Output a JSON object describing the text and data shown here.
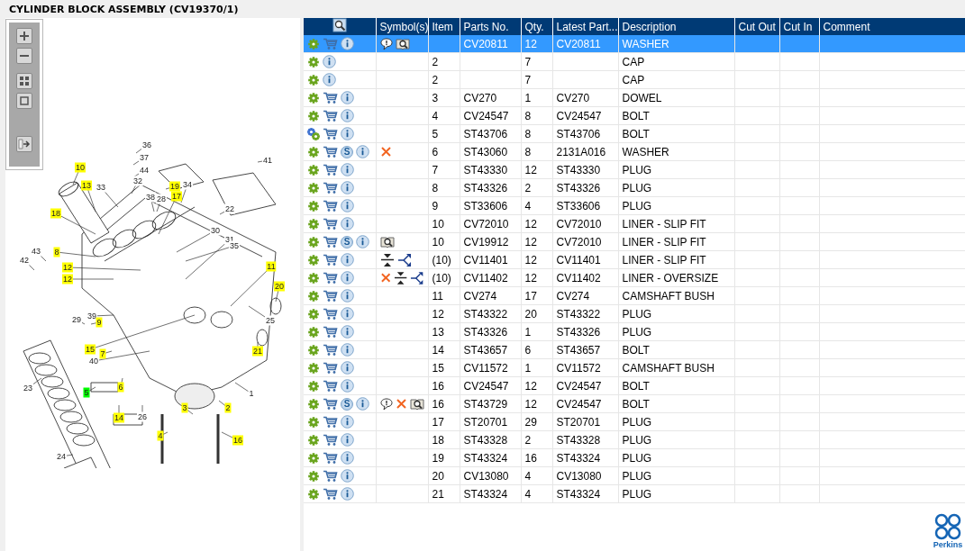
{
  "title": "CYLINDER BLOCK ASSEMBLY (CV19370/1)",
  "toolbar": [
    {
      "kind": "zoom-in"
    },
    {
      "kind": "zoom-out"
    },
    {
      "kind": "fit"
    },
    {
      "kind": "actual"
    },
    {
      "kind": "export"
    }
  ],
  "callouts": [
    {
      "label": "36"
    },
    {
      "label": "37"
    },
    {
      "label": "44"
    },
    {
      "label": "41"
    },
    {
      "label": "10",
      "color": "#ffff00"
    },
    {
      "label": "13",
      "color": "#ffff00"
    },
    {
      "label": "33"
    },
    {
      "label": "32"
    },
    {
      "label": "19",
      "color": "#ffff00"
    },
    {
      "label": "34"
    },
    {
      "label": "38"
    },
    {
      "label": "28"
    },
    {
      "label": "17",
      "color": "#ffff00"
    },
    {
      "label": "22"
    },
    {
      "label": "18",
      "color": "#ffff00"
    },
    {
      "label": "30"
    },
    {
      "label": "31"
    },
    {
      "label": "43"
    },
    {
      "label": "35"
    },
    {
      "label": "42"
    },
    {
      "label": "8",
      "color": "#ffff00"
    },
    {
      "label": "12",
      "color": "#ffff00"
    },
    {
      "label": "12",
      "color": "#ffff00"
    },
    {
      "label": "11",
      "color": "#ffff00"
    },
    {
      "label": "20",
      "color": "#ffff00"
    },
    {
      "label": "39"
    },
    {
      "label": "29"
    },
    {
      "label": "9",
      "color": "#ffff00"
    },
    {
      "label": "25"
    },
    {
      "label": "15",
      "color": "#ffff00"
    },
    {
      "label": "7",
      "color": "#ffff00"
    },
    {
      "label": "40"
    },
    {
      "label": "21",
      "color": "#ffff00"
    },
    {
      "label": "23"
    },
    {
      "label": "5",
      "color": "#00ff00"
    },
    {
      "label": "6",
      "color": "#ffff00"
    },
    {
      "label": "1"
    },
    {
      "label": "3",
      "color": "#ffff00"
    },
    {
      "label": "2",
      "color": "#ffff00"
    },
    {
      "label": "14",
      "color": "#ffff00"
    },
    {
      "label": "26"
    },
    {
      "label": "4",
      "color": "#ffff00"
    },
    {
      "label": "16",
      "color": "#ffff00"
    },
    {
      "label": "24"
    }
  ],
  "table": {
    "columns": [
      "Symbol(s)",
      "Item",
      "Parts No.",
      "Qty.",
      "Latest Part...",
      "Description",
      "Cut Out",
      "Cut In",
      "Comment"
    ],
    "rows": [
      {
        "selected": true,
        "icons": [
          {
            "kind": "gear"
          },
          {
            "kind": "cart"
          },
          {
            "kind": "info"
          }
        ],
        "symbols": [
          {
            "kind": "note"
          },
          {
            "kind": "book"
          }
        ],
        "item": "",
        "part": "CV20811",
        "qty": "12",
        "latest": "CV20811",
        "description": "WASHER"
      },
      {
        "selected": false,
        "icons": [
          {
            "kind": "gear"
          },
          {
            "kind": "info"
          }
        ],
        "symbols": [],
        "item": "2",
        "part": "",
        "qty": "7",
        "latest": "",
        "description": "CAP"
      },
      {
        "selected": false,
        "icons": [
          {
            "kind": "gear"
          },
          {
            "kind": "info"
          }
        ],
        "symbols": [],
        "item": "2",
        "part": "",
        "qty": "7",
        "latest": "",
        "description": "CAP"
      },
      {
        "selected": false,
        "icons": [
          {
            "kind": "gear"
          },
          {
            "kind": "cart"
          },
          {
            "kind": "info"
          }
        ],
        "symbols": [],
        "item": "3",
        "part": "CV270",
        "qty": "1",
        "latest": "CV270",
        "description": "DOWEL"
      },
      {
        "selected": false,
        "icons": [
          {
            "kind": "gear"
          },
          {
            "kind": "cart"
          },
          {
            "kind": "info"
          }
        ],
        "symbols": [],
        "item": "4",
        "part": "CV24547",
        "qty": "8",
        "latest": "CV24547",
        "description": "BOLT"
      },
      {
        "selected": false,
        "icons": [
          {
            "kind": "gears"
          },
          {
            "kind": "cart"
          },
          {
            "kind": "info"
          }
        ],
        "symbols": [],
        "item": "5",
        "part": "ST43706",
        "qty": "8",
        "latest": "ST43706",
        "description": "BOLT"
      },
      {
        "selected": false,
        "icons": [
          {
            "kind": "gear"
          },
          {
            "kind": "cart"
          },
          {
            "kind": "badge",
            "label": "S"
          },
          {
            "kind": "info"
          }
        ],
        "symbols": [
          {
            "kind": "cross"
          }
        ],
        "item": "6",
        "part": "ST43060",
        "qty": "8",
        "latest": "2131A016",
        "description": "WASHER"
      },
      {
        "selected": false,
        "icons": [
          {
            "kind": "gear"
          },
          {
            "kind": "cart"
          },
          {
            "kind": "info"
          }
        ],
        "symbols": [],
        "item": "7",
        "part": "ST43330",
        "qty": "12",
        "latest": "ST43330",
        "description": "PLUG"
      },
      {
        "selected": false,
        "icons": [
          {
            "kind": "gear"
          },
          {
            "kind": "cart"
          },
          {
            "kind": "info"
          }
        ],
        "symbols": [],
        "item": "8",
        "part": "ST43326",
        "qty": "2",
        "latest": "ST43326",
        "description": "PLUG"
      },
      {
        "selected": false,
        "icons": [
          {
            "kind": "gear"
          },
          {
            "kind": "cart"
          },
          {
            "kind": "info"
          }
        ],
        "symbols": [],
        "item": "9",
        "part": "ST33606",
        "qty": "4",
        "latest": "ST33606",
        "description": "PLUG"
      },
      {
        "selected": false,
        "icons": [
          {
            "kind": "gear"
          },
          {
            "kind": "cart"
          },
          {
            "kind": "info"
          }
        ],
        "symbols": [],
        "item": "10",
        "part": "CV72010",
        "qty": "12",
        "latest": "CV72010",
        "description": "LINER - SLIP FIT"
      },
      {
        "selected": false,
        "icons": [
          {
            "kind": "gear"
          },
          {
            "kind": "cart"
          },
          {
            "kind": "badge",
            "label": "S"
          },
          {
            "kind": "info"
          }
        ],
        "symbols": [
          {
            "kind": "book"
          }
        ],
        "item": "10",
        "part": "CV19912",
        "qty": "12",
        "latest": "CV72010",
        "description": "LINER - SLIP FIT"
      },
      {
        "selected": false,
        "icons": [
          {
            "kind": "gear"
          },
          {
            "kind": "cart"
          },
          {
            "kind": "info"
          }
        ],
        "symbols": [
          {
            "kind": "split"
          },
          {
            "kind": "branch"
          }
        ],
        "item": "(10)",
        "part": "CV11401",
        "qty": "12",
        "latest": "CV11401",
        "description": "LINER - SLIP FIT"
      },
      {
        "selected": false,
        "icons": [
          {
            "kind": "gear"
          },
          {
            "kind": "cart"
          },
          {
            "kind": "info"
          }
        ],
        "symbols": [
          {
            "kind": "cross"
          },
          {
            "kind": "split"
          },
          {
            "kind": "branch"
          }
        ],
        "item": "(10)",
        "part": "CV11402",
        "qty": "12",
        "latest": "CV11402",
        "description": "LINER - OVERSIZE"
      },
      {
        "selected": false,
        "icons": [
          {
            "kind": "gear"
          },
          {
            "kind": "cart"
          },
          {
            "kind": "info"
          }
        ],
        "symbols": [],
        "item": "11",
        "part": "CV274",
        "qty": "17",
        "latest": "CV274",
        "description": "CAMSHAFT BUSH"
      },
      {
        "selected": false,
        "icons": [
          {
            "kind": "gear"
          },
          {
            "kind": "cart"
          },
          {
            "kind": "info"
          }
        ],
        "symbols": [],
        "item": "12",
        "part": "ST43322",
        "qty": "20",
        "latest": "ST43322",
        "description": "PLUG"
      },
      {
        "selected": false,
        "icons": [
          {
            "kind": "gear"
          },
          {
            "kind": "cart"
          },
          {
            "kind": "info"
          }
        ],
        "symbols": [],
        "item": "13",
        "part": "ST43326",
        "qty": "1",
        "latest": "ST43326",
        "description": "PLUG"
      },
      {
        "selected": false,
        "icons": [
          {
            "kind": "gear"
          },
          {
            "kind": "cart"
          },
          {
            "kind": "info"
          }
        ],
        "symbols": [],
        "item": "14",
        "part": "ST43657",
        "qty": "6",
        "latest": "ST43657",
        "description": "BOLT"
      },
      {
        "selected": false,
        "icons": [
          {
            "kind": "gear"
          },
          {
            "kind": "cart"
          },
          {
            "kind": "info"
          }
        ],
        "symbols": [],
        "item": "15",
        "part": "CV11572",
        "qty": "1",
        "latest": "CV11572",
        "description": "CAMSHAFT BUSH"
      },
      {
        "selected": false,
        "icons": [
          {
            "kind": "gear"
          },
          {
            "kind": "cart"
          },
          {
            "kind": "info"
          }
        ],
        "symbols": [],
        "item": "16",
        "part": "CV24547",
        "qty": "12",
        "latest": "CV24547",
        "description": "BOLT"
      },
      {
        "selected": false,
        "icons": [
          {
            "kind": "gear"
          },
          {
            "kind": "cart"
          },
          {
            "kind": "badge",
            "label": "S"
          },
          {
            "kind": "info"
          }
        ],
        "symbols": [
          {
            "kind": "note"
          },
          {
            "kind": "cross"
          },
          {
            "kind": "book"
          }
        ],
        "item": "16",
        "part": "ST43729",
        "qty": "12",
        "latest": "CV24547",
        "description": "BOLT"
      },
      {
        "selected": false,
        "icons": [
          {
            "kind": "gear"
          },
          {
            "kind": "cart"
          },
          {
            "kind": "info"
          }
        ],
        "symbols": [],
        "item": "17",
        "part": "ST20701",
        "qty": "29",
        "latest": "ST20701",
        "description": "PLUG"
      },
      {
        "selected": false,
        "icons": [
          {
            "kind": "gear"
          },
          {
            "kind": "cart"
          },
          {
            "kind": "info"
          }
        ],
        "symbols": [],
        "item": "18",
        "part": "ST43328",
        "qty": "2",
        "latest": "ST43328",
        "description": "PLUG"
      },
      {
        "selected": false,
        "icons": [
          {
            "kind": "gear"
          },
          {
            "kind": "cart"
          },
          {
            "kind": "info"
          }
        ],
        "symbols": [],
        "item": "19",
        "part": "ST43324",
        "qty": "16",
        "latest": "ST43324",
        "description": "PLUG"
      },
      {
        "selected": false,
        "icons": [
          {
            "kind": "gear"
          },
          {
            "kind": "cart"
          },
          {
            "kind": "info"
          }
        ],
        "symbols": [],
        "item": "20",
        "part": "CV13080",
        "qty": "4",
        "latest": "CV13080",
        "description": "PLUG"
      },
      {
        "selected": false,
        "icons": [
          {
            "kind": "gear"
          },
          {
            "kind": "cart"
          },
          {
            "kind": "info"
          }
        ],
        "symbols": [],
        "item": "21",
        "part": "ST43324",
        "qty": "4",
        "latest": "ST43324",
        "description": "PLUG"
      }
    ]
  },
  "logo": {
    "text": "Perkins"
  }
}
